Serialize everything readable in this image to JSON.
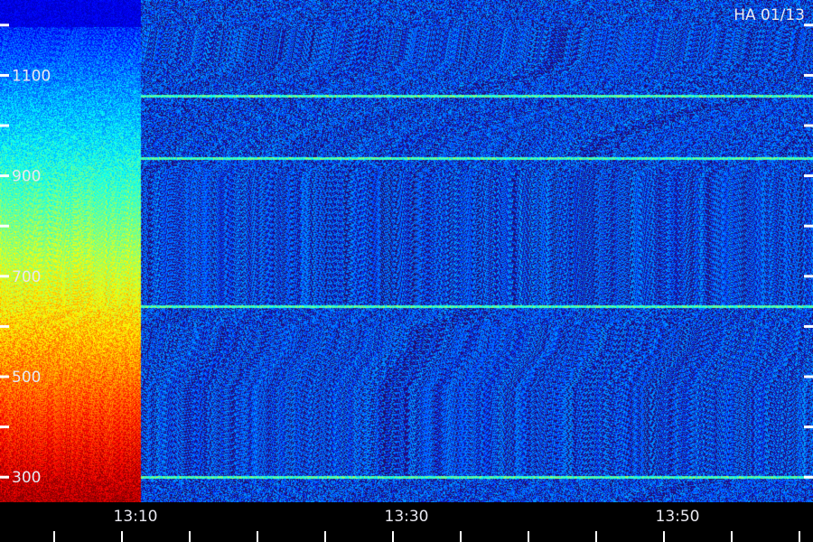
{
  "header": {
    "station_label": "HA 01/13"
  },
  "chart_data": {
    "type": "heatmap",
    "title": "",
    "xlabel": "",
    "ylabel": "",
    "x_tick_labels": [
      "13:10",
      "13:30",
      "13:50"
    ],
    "y_tick_labels": [
      "1100",
      "900",
      "700",
      "500",
      "300"
    ],
    "y_tick_values": [
      1100,
      900,
      700,
      500,
      300
    ],
    "ylim": [
      250,
      1250
    ],
    "xlim_minutes": [
      13.0,
      13.0
    ],
    "x_major_ticks_minutes": [
      10,
      30,
      50
    ],
    "grid": false,
    "colormap": "jet",
    "noise_floor_color": "#1a0f7a",
    "emission_feature": {
      "description_time": "13:10",
      "end_minute": 10.4,
      "color_low_freq": "#ff2200",
      "color_high_freq": "#1a3cff"
    },
    "horizontal_lines_mhz": [
      300,
      640,
      935,
      1060
    ]
  }
}
